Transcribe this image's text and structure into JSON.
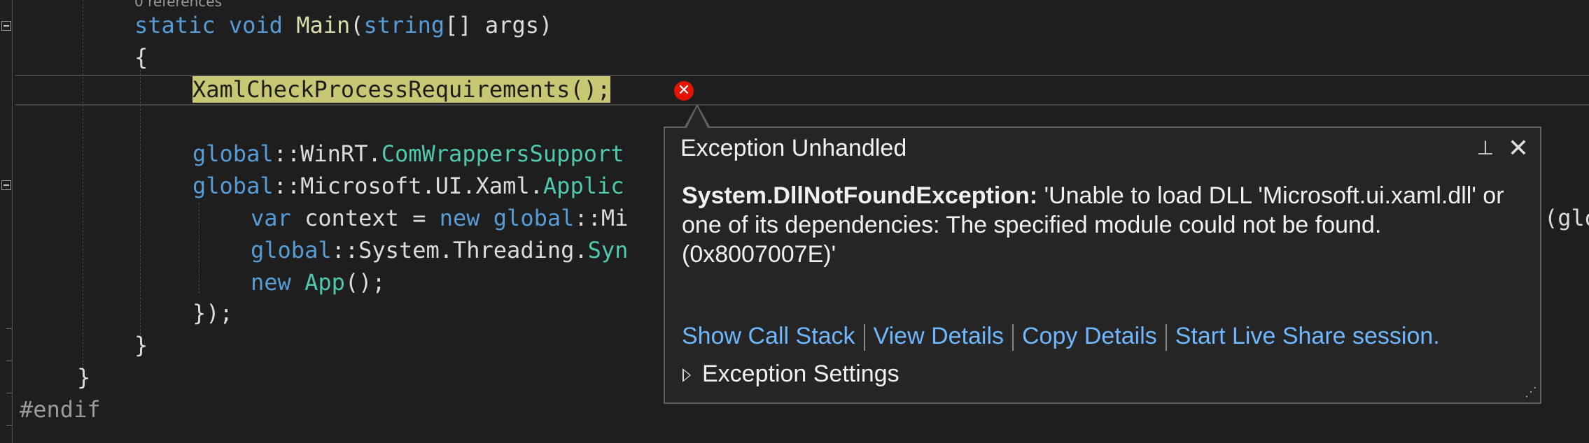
{
  "editor": {
    "codelens": "0 references",
    "line1": {
      "kw1": "static",
      "kw2": "void",
      "fn": "Main",
      "p1": "(",
      "kw3": "string",
      "rest": "[] args)"
    },
    "line2": "{",
    "line3": {
      "call": "XamlCheckProcessRequirements",
      "rest": "();"
    },
    "line5": {
      "kw": "global",
      "mid": "::WinRT.",
      "ty": "ComWrappersSupport"
    },
    "line6": {
      "kw": "global",
      "mid": "::Microsoft.UI.Xaml.",
      "ty": "Applic"
    },
    "line7": {
      "kw1": "var",
      "mid1": " context = ",
      "kw2": "new",
      "sp": " ",
      "kw3": "global",
      "rest": "::Mi"
    },
    "line7_right": "(glo",
    "line8": {
      "kw": "global",
      "mid": "::System.Threading.",
      "ty": "Syn"
    },
    "line9": {
      "kw": "new",
      "sp": " ",
      "ty": "App",
      "rest": "();"
    },
    "line10": "});",
    "line11": "}",
    "line12": "}",
    "line13": "#endif"
  },
  "error_glyph": "✕",
  "exception_popup": {
    "title": "Exception Unhandled",
    "exception_type": "System.DllNotFoundException:",
    "message": " 'Unable to load DLL 'Microsoft.ui.xaml.dll' or one of its dependencies: The specified module could not be found. (0x8007007E)'",
    "links": {
      "call_stack": "Show Call Stack",
      "view_details": "View Details",
      "copy_details": "Copy Details",
      "live_share": "Start Live Share session."
    },
    "settings_label": "Exception Settings",
    "pin_icon": "⊥",
    "close_icon": "✕",
    "grip_icon": "⋰"
  },
  "colors": {
    "background": "#1e1e1e",
    "keyword": "#569cd6",
    "type": "#4ec9b0",
    "function": "#dcdcaa",
    "link": "#6fb7ff",
    "error": "#e51400"
  }
}
